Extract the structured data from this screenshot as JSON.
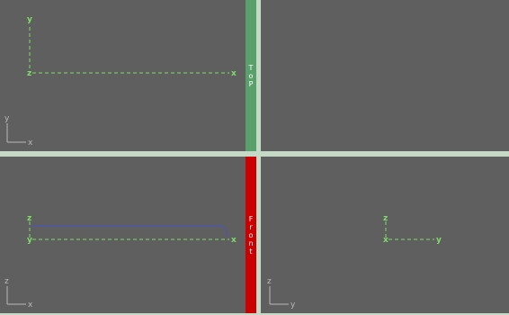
{
  "colors": {
    "viewport_bg": "#5f5f5f",
    "frame": "#c6d8c6",
    "axis": "#7fdc6a",
    "gizmo": "#b8b8b8",
    "curve": "#4a52c8",
    "top_tab": "#5aa06b",
    "front_tab": "#cc0000"
  },
  "viewports": {
    "top": {
      "tab_label": [
        "T",
        "o",
        "P"
      ],
      "axis_labels": {
        "vertical": "y",
        "horizontal": "x",
        "origin": "z"
      },
      "gizmo": {
        "vertical": "y",
        "horizontal": "x"
      }
    },
    "front": {
      "tab_label": [
        "F",
        "r",
        "o",
        "n",
        "t"
      ],
      "axis_labels": {
        "vertical": "z",
        "horizontal": "x",
        "origin": "y"
      },
      "gizmo": {
        "vertical": "z",
        "horizontal": "x"
      }
    },
    "side": {
      "axis_labels": {
        "vertical": "z",
        "horizontal": "y",
        "origin": "x"
      },
      "gizmo": {
        "vertical": "z",
        "horizontal": "y"
      }
    }
  }
}
